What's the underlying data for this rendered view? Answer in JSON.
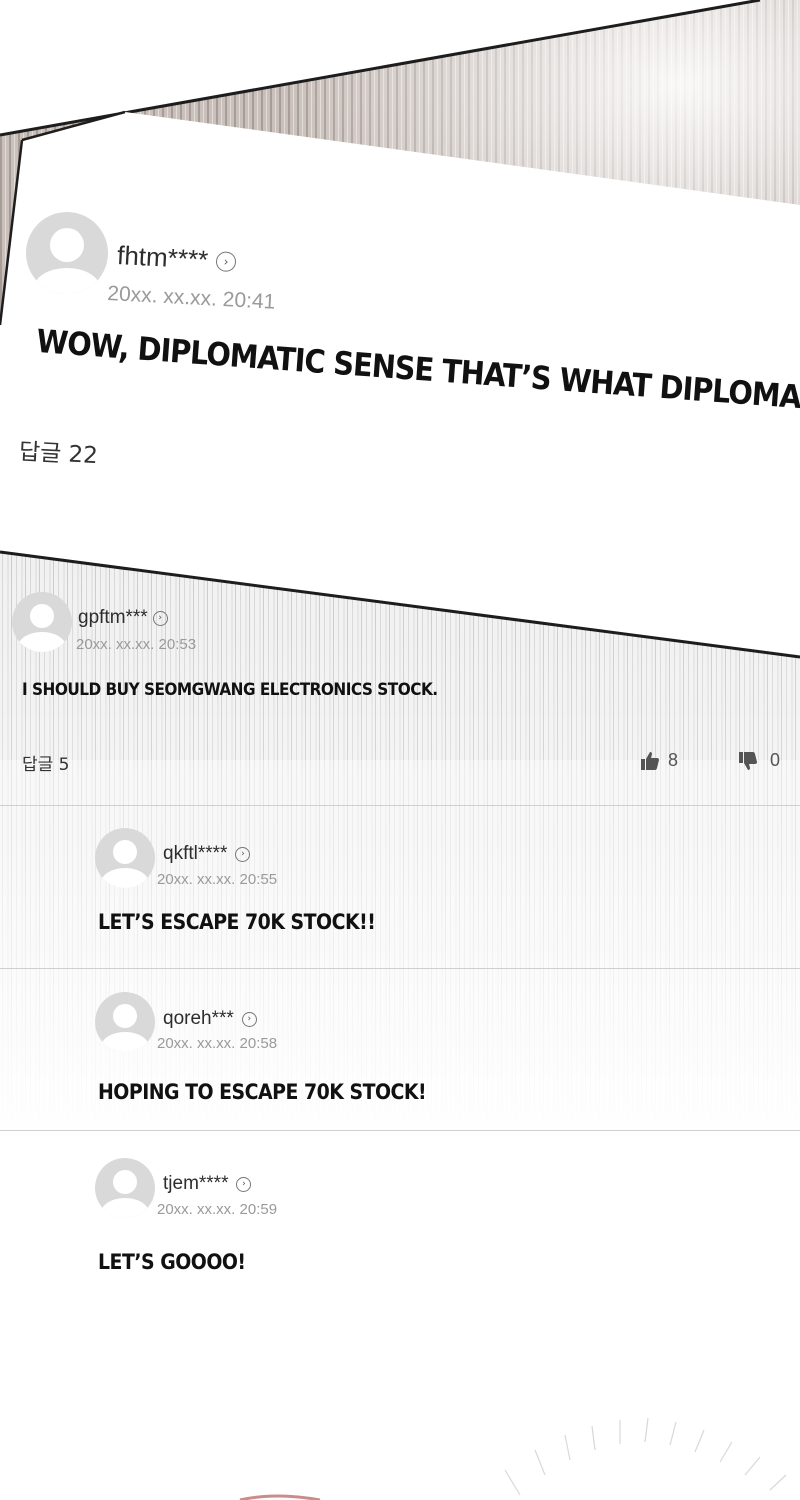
{
  "comments": [
    {
      "username": "fhtm****",
      "timestamp": "20xx. xx.xx. 20:41",
      "text": "WOW, DIPLOMATIC SENSE THAT’S WHAT DIPLOMACY IS.",
      "replies_label": "답글 22"
    },
    {
      "username": "gpftm***",
      "timestamp": "20xx. xx.xx. 20:53",
      "text": "I SHOULD BUY SEOMGWANG ELECTRONICS STOCK.",
      "replies_label": "답글 5",
      "likes": "8",
      "dislikes": "0"
    }
  ],
  "replies": [
    {
      "username": "qkftl****",
      "timestamp": "20xx. xx.xx. 20:55",
      "text": "LET’S ESCAPE 70K STOCK!!"
    },
    {
      "username": "qoreh***",
      "timestamp": "20xx. xx.xx. 20:58",
      "text": "HOPING TO ESCAPE 70K STOCK!"
    },
    {
      "username": "tjem****",
      "timestamp": "20xx. xx.xx. 20:59",
      "text": "LET’S GOOOO!"
    }
  ],
  "icons": {
    "profile_arrow": "chevron-right-icon",
    "like": "thumbs-up-icon",
    "dislike": "thumbs-down-icon"
  },
  "colors": {
    "panel_stripes": "#bdb3ad",
    "avatar": "#d9d9d9",
    "timestamp": "#9a9a9a"
  }
}
